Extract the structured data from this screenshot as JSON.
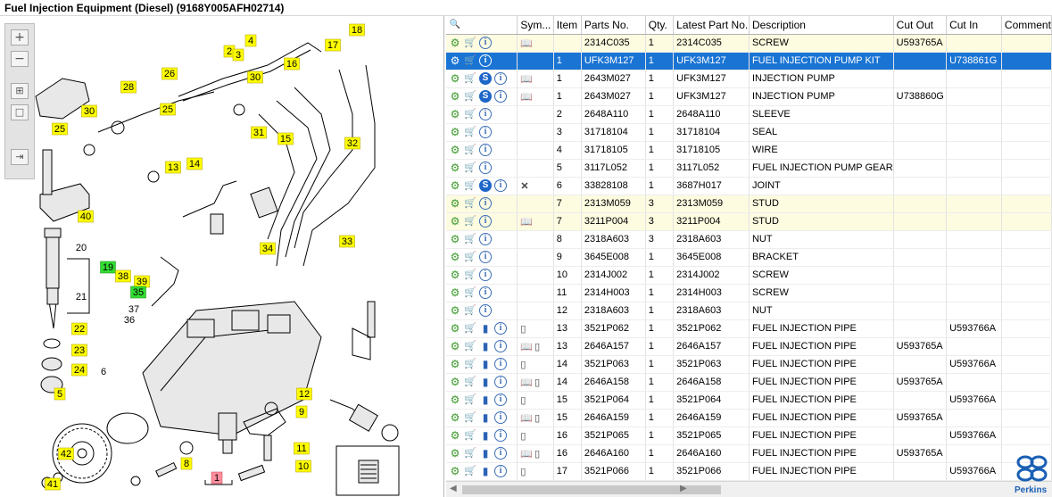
{
  "window": {
    "title": "Fuel Injection Equipment (Diesel) (9168Y005AFH02714)"
  },
  "toolbar": {
    "zoom_in_icon": "zoom-in-icon",
    "zoom_out_icon": "zoom-out-icon",
    "fit_icon": "fit-icon",
    "actual_icon": "actual-size-icon",
    "export_icon": "export-icon"
  },
  "diagram": {
    "callouts": [
      {
        "label": "4"
      },
      {
        "label": "2"
      },
      {
        "label": "3"
      },
      {
        "label": "18"
      },
      {
        "label": "17"
      },
      {
        "label": "26"
      },
      {
        "label": "28"
      },
      {
        "label": "30"
      },
      {
        "label": "16"
      },
      {
        "label": "30"
      },
      {
        "label": "25"
      },
      {
        "label": "25"
      },
      {
        "label": "31"
      },
      {
        "label": "15"
      },
      {
        "label": "13"
      },
      {
        "label": "14"
      },
      {
        "label": "32"
      },
      {
        "label": "40"
      },
      {
        "label": "33"
      },
      {
        "label": "34"
      },
      {
        "label": "19"
      },
      {
        "label": "38"
      },
      {
        "label": "39"
      },
      {
        "label": "35"
      },
      {
        "label": "22"
      },
      {
        "label": "23"
      },
      {
        "label": "24"
      },
      {
        "label": "12"
      },
      {
        "label": "9"
      },
      {
        "label": "5"
      },
      {
        "label": "8"
      },
      {
        "label": "11"
      },
      {
        "label": "10"
      },
      {
        "label": "42"
      },
      {
        "label": "41"
      },
      {
        "label": "1"
      }
    ],
    "plain_labels": [
      {
        "label": "20"
      },
      {
        "label": "21"
      },
      {
        "label": "37"
      },
      {
        "label": "36"
      },
      {
        "label": "6"
      }
    ]
  },
  "grid": {
    "headers": {
      "search_icon": "search-icon",
      "sym": "Sym...",
      "item": "Item",
      "parts_no": "Parts No.",
      "qty": "Qty.",
      "latest": "Latest Part No.",
      "description": "Description",
      "cut_out": "Cut Out",
      "cut_in": "Cut In",
      "comment": "Comment"
    },
    "rows": [
      {
        "icons": [
          "gear",
          "cart",
          "info"
        ],
        "sym": [
          "book"
        ],
        "item": "",
        "parts_no": "2314C035",
        "qty": "1",
        "latest": "2314C035",
        "description": "SCREW",
        "cut_out": "U593765A",
        "cut_in": "",
        "comment": "",
        "state": "highlight"
      },
      {
        "icons": [
          "gear",
          "cart",
          "info"
        ],
        "sym": [],
        "item": "1",
        "parts_no": "UFK3M127",
        "qty": "1",
        "latest": "UFK3M127",
        "description": "FUEL INJECTION PUMP KIT",
        "cut_out": "",
        "cut_in": "U738861G",
        "comment": "",
        "state": "selected"
      },
      {
        "icons": [
          "gears",
          "cart",
          "s",
          "info"
        ],
        "sym": [
          "book"
        ],
        "item": "1",
        "parts_no": "2643M027",
        "qty": "1",
        "latest": "UFK3M127",
        "description": "INJECTION PUMP",
        "cut_out": "",
        "cut_in": "",
        "comment": "",
        "state": ""
      },
      {
        "icons": [
          "gear",
          "cart",
          "s",
          "info"
        ],
        "sym": [
          "book"
        ],
        "item": "1",
        "parts_no": "2643M027",
        "qty": "1",
        "latest": "UFK3M127",
        "description": "INJECTION PUMP",
        "cut_out": "U738860G",
        "cut_in": "",
        "comment": "",
        "state": ""
      },
      {
        "icons": [
          "gear",
          "cart",
          "info"
        ],
        "sym": [],
        "item": "2",
        "parts_no": "2648A110",
        "qty": "1",
        "latest": "2648A110",
        "description": "SLEEVE",
        "cut_out": "",
        "cut_in": "",
        "comment": "",
        "state": ""
      },
      {
        "icons": [
          "gear",
          "cart",
          "info"
        ],
        "sym": [],
        "item": "3",
        "parts_no": "31718104",
        "qty": "1",
        "latest": "31718104",
        "description": "SEAL",
        "cut_out": "",
        "cut_in": "",
        "comment": "",
        "state": ""
      },
      {
        "icons": [
          "gear",
          "cart",
          "info"
        ],
        "sym": [],
        "item": "4",
        "parts_no": "31718105",
        "qty": "1",
        "latest": "31718105",
        "description": "WIRE",
        "cut_out": "",
        "cut_in": "",
        "comment": "",
        "state": ""
      },
      {
        "icons": [
          "gear",
          "cart",
          "info"
        ],
        "sym": [],
        "item": "5",
        "parts_no": "3117L052",
        "qty": "1",
        "latest": "3117L052",
        "description": "FUEL INJECTION PUMP GEAR",
        "cut_out": "",
        "cut_in": "",
        "comment": "",
        "state": ""
      },
      {
        "icons": [
          "gear",
          "cart",
          "s",
          "info"
        ],
        "sym": [
          "x"
        ],
        "item": "6",
        "parts_no": "33828108",
        "qty": "1",
        "latest": "3687H017",
        "description": "JOINT",
        "cut_out": "",
        "cut_in": "",
        "comment": "",
        "state": ""
      },
      {
        "icons": [
          "gear",
          "cart",
          "info"
        ],
        "sym": [],
        "item": "7",
        "parts_no": "2313M059",
        "qty": "3",
        "latest": "2313M059",
        "description": "STUD",
        "cut_out": "",
        "cut_in": "",
        "comment": "",
        "state": "highlight"
      },
      {
        "icons": [
          "gear",
          "cart",
          "info"
        ],
        "sym": [
          "book"
        ],
        "item": "7",
        "parts_no": "3211P004",
        "qty": "3",
        "latest": "3211P004",
        "description": "STUD",
        "cut_out": "",
        "cut_in": "",
        "comment": "",
        "state": "highlight"
      },
      {
        "icons": [
          "gear",
          "cart",
          "info"
        ],
        "sym": [],
        "item": "8",
        "parts_no": "2318A603",
        "qty": "3",
        "latest": "2318A603",
        "description": "NUT",
        "cut_out": "",
        "cut_in": "",
        "comment": "",
        "state": ""
      },
      {
        "icons": [
          "gear",
          "cart",
          "info"
        ],
        "sym": [],
        "item": "9",
        "parts_no": "3645E008",
        "qty": "1",
        "latest": "3645E008",
        "description": "BRACKET",
        "cut_out": "",
        "cut_in": "",
        "comment": "",
        "state": ""
      },
      {
        "icons": [
          "gear",
          "cart",
          "info"
        ],
        "sym": [],
        "item": "10",
        "parts_no": "2314J002",
        "qty": "1",
        "latest": "2314J002",
        "description": "SCREW",
        "cut_out": "",
        "cut_in": "",
        "comment": "",
        "state": ""
      },
      {
        "icons": [
          "gear",
          "cart",
          "info"
        ],
        "sym": [],
        "item": "11",
        "parts_no": "2314H003",
        "qty": "1",
        "latest": "2314H003",
        "description": "SCREW",
        "cut_out": "",
        "cut_in": "",
        "comment": "",
        "state": ""
      },
      {
        "icons": [
          "gear",
          "cart",
          "info"
        ],
        "sym": [],
        "item": "12",
        "parts_no": "2318A603",
        "qty": "1",
        "latest": "2318A603",
        "description": "NUT",
        "cut_out": "",
        "cut_in": "",
        "comment": "",
        "state": ""
      },
      {
        "icons": [
          "gear",
          "cart",
          "bookmark",
          "info"
        ],
        "sym": [
          "can"
        ],
        "item": "13",
        "parts_no": "3521P062",
        "qty": "1",
        "latest": "3521P062",
        "description": "FUEL INJECTION PIPE",
        "cut_out": "",
        "cut_in": "U593766A",
        "comment": "",
        "state": ""
      },
      {
        "icons": [
          "gear",
          "cart",
          "bookmark",
          "info"
        ],
        "sym": [
          "book",
          "can"
        ],
        "item": "13",
        "parts_no": "2646A157",
        "qty": "1",
        "latest": "2646A157",
        "description": "FUEL INJECTION PIPE",
        "cut_out": "U593765A",
        "cut_in": "",
        "comment": "",
        "state": ""
      },
      {
        "icons": [
          "gear",
          "cart",
          "bookmark",
          "info"
        ],
        "sym": [
          "can"
        ],
        "item": "14",
        "parts_no": "3521P063",
        "qty": "1",
        "latest": "3521P063",
        "description": "FUEL INJECTION PIPE",
        "cut_out": "",
        "cut_in": "U593766A",
        "comment": "",
        "state": ""
      },
      {
        "icons": [
          "gear",
          "cart",
          "bookmark",
          "info"
        ],
        "sym": [
          "book",
          "can"
        ],
        "item": "14",
        "parts_no": "2646A158",
        "qty": "1",
        "latest": "2646A158",
        "description": "FUEL INJECTION PIPE",
        "cut_out": "U593765A",
        "cut_in": "",
        "comment": "",
        "state": ""
      },
      {
        "icons": [
          "gear",
          "cart",
          "bookmark",
          "info"
        ],
        "sym": [
          "can"
        ],
        "item": "15",
        "parts_no": "3521P064",
        "qty": "1",
        "latest": "3521P064",
        "description": "FUEL INJECTION PIPE",
        "cut_out": "",
        "cut_in": "U593766A",
        "comment": "",
        "state": ""
      },
      {
        "icons": [
          "gear",
          "cart",
          "bookmark",
          "info"
        ],
        "sym": [
          "book",
          "can"
        ],
        "item": "15",
        "parts_no": "2646A159",
        "qty": "1",
        "latest": "2646A159",
        "description": "FUEL INJECTION PIPE",
        "cut_out": "U593765A",
        "cut_in": "",
        "comment": "",
        "state": ""
      },
      {
        "icons": [
          "gear",
          "cart",
          "bookmark",
          "info"
        ],
        "sym": [
          "can"
        ],
        "item": "16",
        "parts_no": "3521P065",
        "qty": "1",
        "latest": "3521P065",
        "description": "FUEL INJECTION PIPE",
        "cut_out": "",
        "cut_in": "U593766A",
        "comment": "",
        "state": ""
      },
      {
        "icons": [
          "gear",
          "cart",
          "bookmark",
          "info"
        ],
        "sym": [
          "book",
          "can"
        ],
        "item": "16",
        "parts_no": "2646A160",
        "qty": "1",
        "latest": "2646A160",
        "description": "FUEL INJECTION PIPE",
        "cut_out": "U593765A",
        "cut_in": "",
        "comment": "",
        "state": ""
      },
      {
        "icons": [
          "gear",
          "cart",
          "bookmark",
          "info"
        ],
        "sym": [
          "can"
        ],
        "item": "17",
        "parts_no": "3521P066",
        "qty": "1",
        "latest": "3521P066",
        "description": "FUEL INJECTION PIPE",
        "cut_out": "",
        "cut_in": "U593766A",
        "comment": "",
        "state": ""
      }
    ]
  },
  "brand": {
    "name": "Perkins",
    "color": "#1a5fb4"
  },
  "colors": {
    "selected": "#1a74d4",
    "highlight": "#fdfbe0",
    "callout": "#ffff00",
    "callout_green": "#33dd33",
    "callout_red": "#ff8c9c"
  }
}
